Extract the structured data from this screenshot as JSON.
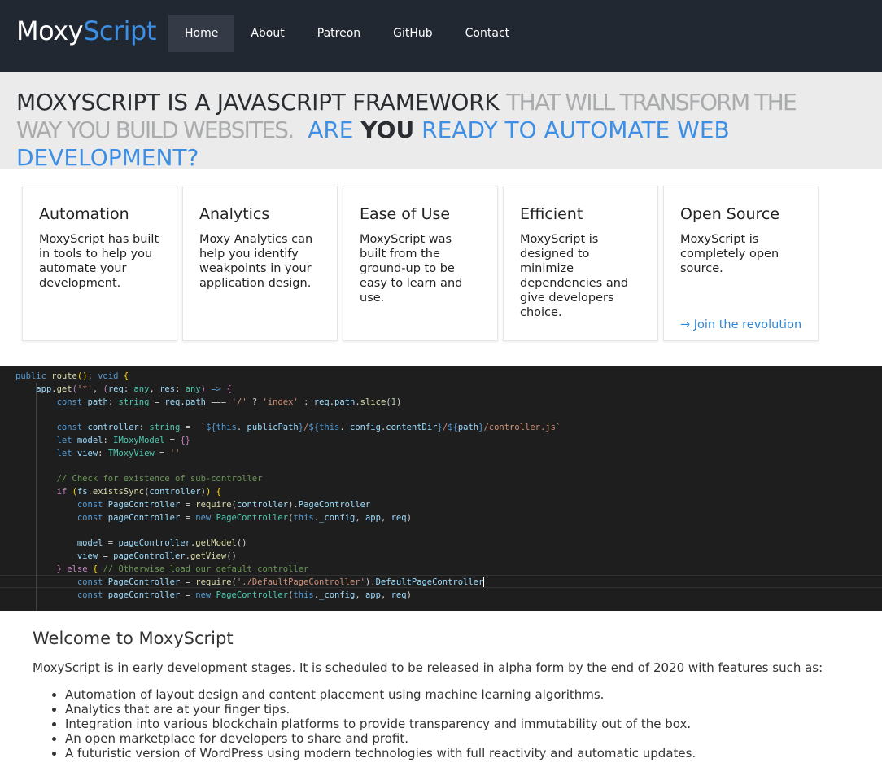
{
  "navbar": {
    "brand_part1": "Moxy",
    "brand_part2": "Script",
    "items": [
      "Home",
      "About",
      "Patreon",
      "GitHub",
      "Contact"
    ],
    "active": "Home"
  },
  "hero": {
    "dark1": "MOXYSCRIPT IS A JAVASCRIPT FRAMEWORK",
    "gray1": "THAT WILL TRANSFORM THE WAY YOU BUILD WEBSITES.",
    "blue1": "ARE",
    "bold": "YOU",
    "blue2": "READY TO AUTOMATE WEB DEVELOPMENT?"
  },
  "cards": [
    {
      "title": "Automation",
      "text": "MoxyScript has built in tools to help you automate your development."
    },
    {
      "title": "Analytics",
      "text": "Moxy Analytics can help you identify weakpoints in your application design."
    },
    {
      "title": "Ease of Use",
      "text": "MoxyScript was built from the ground-up to be easy to learn and use."
    },
    {
      "title": "Efficient",
      "text": "MoxyScript is designed to minimize dependencies and give developers choice."
    },
    {
      "title": "Open Source",
      "text": "MoxyScript is completely open source.",
      "link": "→ Join the revolution"
    }
  ],
  "code_lines": [
    "public route(): void {",
    "    app.get('*', (req: any, res: any) => {",
    "        const path: string = req.path === '/' ? 'index' : req.path.slice(1)",
    "",
    "        const controller: string =  `${this._publicPath}/${this._config.contentDir}/${path}/controller.js`",
    "        let model: IMoxyModel = {}",
    "        let view: TMoxyView = ''",
    "",
    "        // Check for existence of sub-controller",
    "        if (fs.existsSync(controller)) {",
    "            const PageController = require(controller).PageController",
    "            const pageController = new PageController(this._config, app, req)",
    "",
    "            model = pageController.getModel()",
    "            view = pageController.getView()",
    "        } else { // Otherwise load our default controller",
    "            const PageController = require('./DefaultPageController').DefaultPageController",
    "            const pageController = new PageController(this._config, app, req)"
  ],
  "welcome": {
    "title": "Welcome to MoxyScript",
    "intro": "MoxyScript is in early development stages. It is scheduled to be released in alpha form by the end of 2020 with features such as:",
    "features": [
      "Automation of layout design and content placement using machine learning algorithms.",
      "Analytics that are at your finger tips.",
      "Integration into various blockchain platforms to provide transparency and immutability out of the box.",
      "An open marketplace for developers to share and profit.",
      "A futuristic version of WordPress using modern technologies with full reactivity and automatic updates."
    ]
  },
  "colors": {
    "navbar_bg": "#222831",
    "nav_active_bg": "#343b47",
    "accent": "#3d8fe6",
    "hero_bg": "#ebebeb",
    "code_bg": "#1e1e1e"
  }
}
